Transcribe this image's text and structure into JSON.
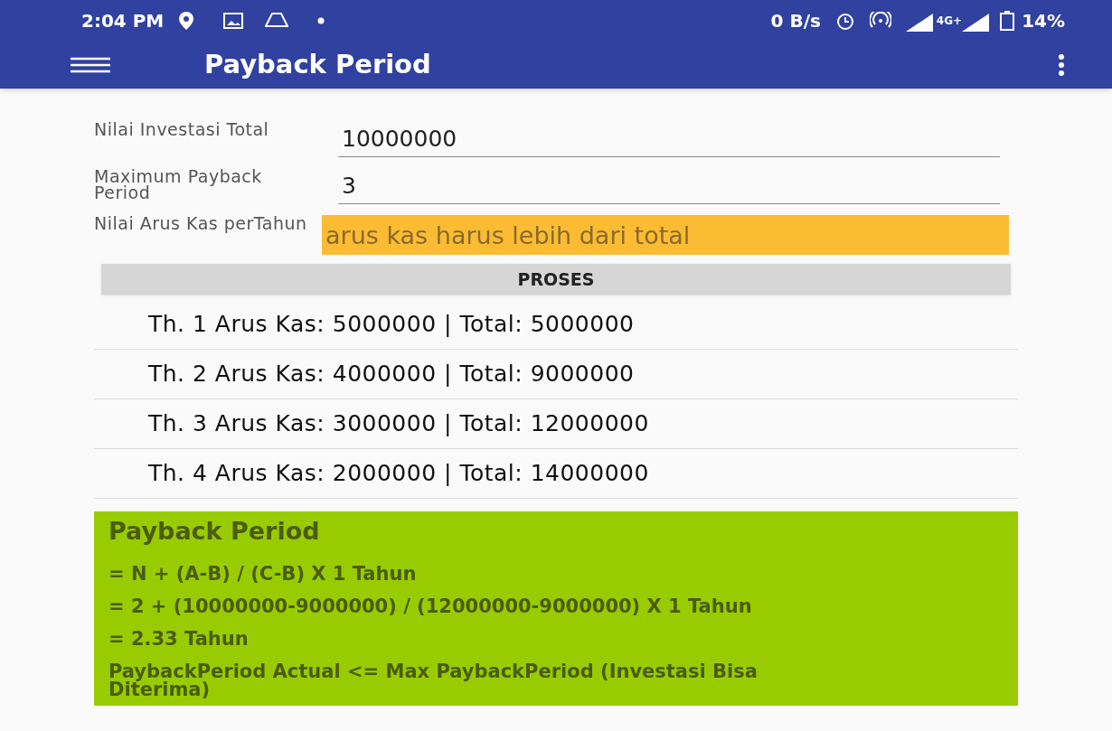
{
  "status_bar": {
    "time": "2:04 PM",
    "speed": "0 B/s",
    "network": "4G+",
    "battery": "14%"
  },
  "app_bar": {
    "title": "Payback Period"
  },
  "fields": [
    {
      "label": "Nilai Investasi Total",
      "value": "10000000",
      "error": false
    },
    {
      "label": "Maximum Payback Period",
      "value": "3",
      "error": false
    },
    {
      "label": "Nilai Arus Kas perTahun",
      "placeholder": "arus kas harus lebih dari total",
      "error": true
    }
  ],
  "process_button": "PROSES",
  "rows": [
    "Th. 1 Arus Kas: 5000000 | Total: 5000000",
    "Th. 2 Arus Kas: 4000000 | Total: 9000000",
    "Th. 3 Arus Kas: 3000000 | Total: 12000000",
    "Th. 4 Arus Kas: 2000000 | Total: 14000000"
  ],
  "result": {
    "title": "Payback Period",
    "lines": [
      "= N + (A-B) / (C-B) X 1 Tahun",
      "= 2 + (10000000-9000000) / (12000000-9000000) X 1 Tahun",
      "= 2.33 Tahun",
      "PaybackPeriod Actual <= Max PaybackPeriod (Investasi Bisa Diterima)"
    ]
  }
}
